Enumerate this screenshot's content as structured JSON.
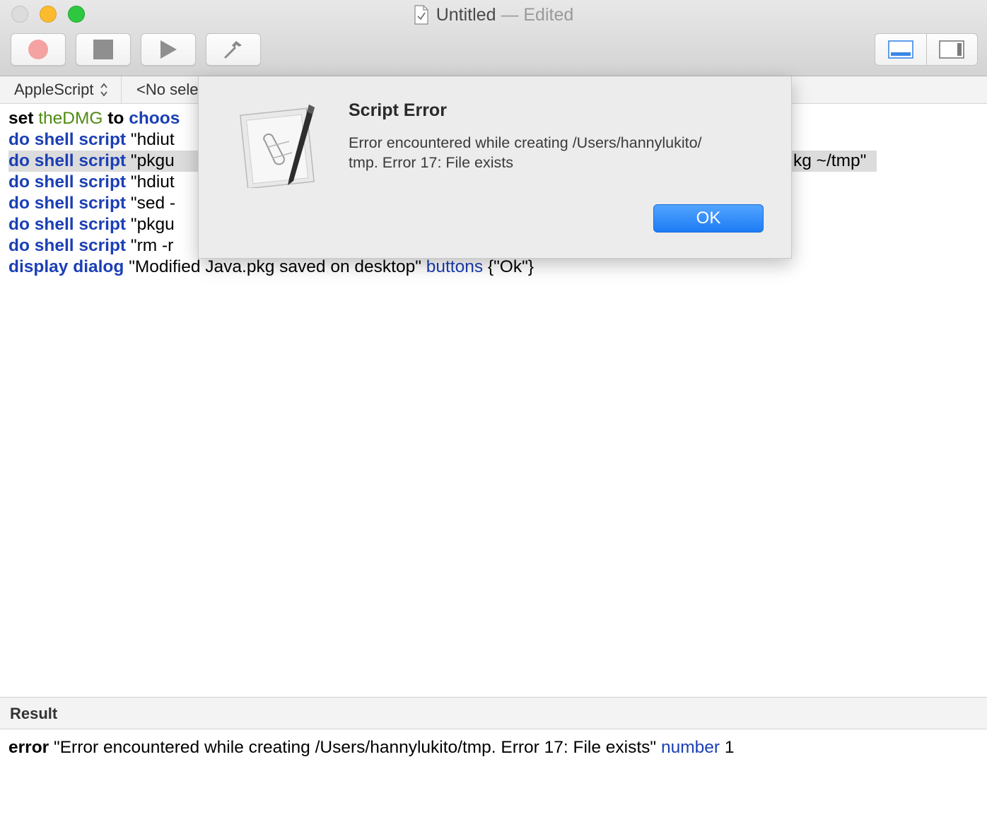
{
  "window": {
    "title": "Untitled",
    "title_suffix": "— Edited"
  },
  "toolbar": {
    "record_icon": "record-icon",
    "stop_icon": "stop-icon",
    "run_icon": "play-icon",
    "compile_icon": "hammer-icon",
    "view_log_icon": "bottom-panel-icon",
    "view_sidebar_icon": "right-sidebar-icon"
  },
  "navbar": {
    "language": "AppleScript",
    "handler": "<No sele"
  },
  "script": {
    "line1": {
      "kw": "set",
      "var": "theDMG",
      "kw2": "to",
      "cmd": "choos"
    },
    "line2": {
      "cmd": "do shell script",
      "arg": "\"hdiut"
    },
    "line3": {
      "cmd": "do shell script",
      "arg": "\"pkgu",
      "tail": "kg ~/tmp\""
    },
    "line4": {
      "cmd": "do shell script",
      "arg": "\"hdiut"
    },
    "line5": {
      "cmd": "do shell script",
      "arg": "\"sed -"
    },
    "line6": {
      "cmd": "do shell script",
      "arg": "\"pkgu"
    },
    "line7": {
      "cmd": "do shell script",
      "arg": "\"rm -r"
    },
    "line8": {
      "cmd": "display dialog",
      "arg": "\"Modified Java.pkg saved on desktop\"",
      "param": "buttons",
      "value": "{\"Ok\"}"
    }
  },
  "result": {
    "header": "Result",
    "kw": "error",
    "message": "\"Error encountered while creating /Users/hannylukito/tmp. Error 17: File exists\"",
    "param": "number",
    "value": "1"
  },
  "alert": {
    "title": "Script Error",
    "message_line1": "Error encountered while creating /Users/hannylukito/",
    "message_line2": "tmp. Error 17: File exists",
    "ok_label": "OK",
    "icon": "script-editor-icon"
  },
  "colors": {
    "keyword_blue": "#1b3fb5",
    "variable_green": "#4f8a10",
    "accent_blue": "#1d7cf5"
  }
}
